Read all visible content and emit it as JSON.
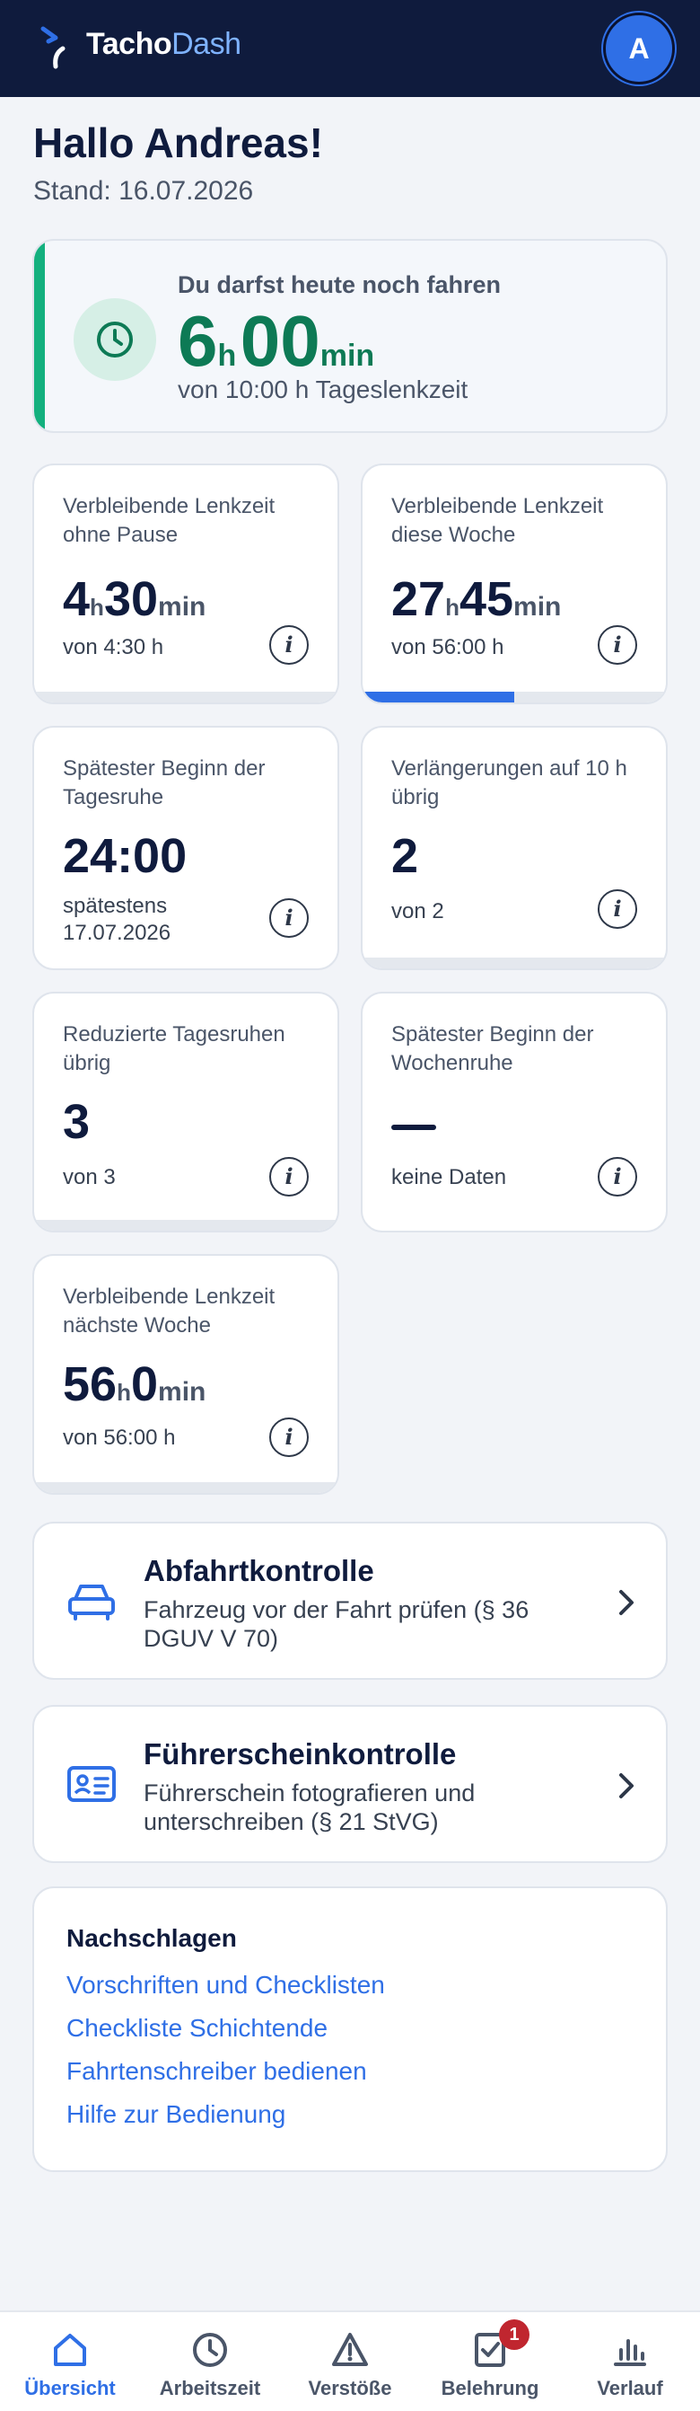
{
  "header": {
    "brand_a": "Tacho",
    "brand_b": "Dash",
    "avatar": "A"
  },
  "greeting": "Hallo Andreas!",
  "stand": "Stand: 16.07.2026",
  "hero": {
    "lead": "Du darfst heute noch fahren",
    "hours": "6",
    "h": "h",
    "minutes": "00",
    "min": "min",
    "sub": "von 10:00 h Tageslenkzeit",
    "accent": "#13b07e"
  },
  "cards": [
    {
      "label": "Verbleibende Lenkzeit ohne Pause",
      "hours": "4",
      "h": "h",
      "minutes": "30",
      "min": "min",
      "caption": "von 4:30 h",
      "progress": 0
    },
    {
      "label": "Verbleibende Lenkzeit diese Woche",
      "hours": "27",
      "h": "h",
      "minutes": "45",
      "min": "min",
      "caption": "von 56:00 h",
      "progress": 0.5
    },
    {
      "label": "Spätester Beginn der Tagesruhe",
      "value": "24:00",
      "caption": "spätestens 17.07.2026"
    },
    {
      "label": "Verlängerungen auf 10 h übrig",
      "value": "2",
      "caption": "von 2",
      "progress": 0
    },
    {
      "label": "Reduzierte Tagesruhen übrig",
      "value": "3",
      "caption": "von 3",
      "progress": 0
    },
    {
      "label": "Spätester Beginn der Wochenruhe",
      "caption": "keine Daten"
    },
    {
      "label": "Verbleibende Lenkzeit nächste Woche",
      "hours": "56",
      "h": "h",
      "minutes": "0",
      "min": "min",
      "caption": "von 56:00 h",
      "progress": 0
    }
  ],
  "info_glyph": "i",
  "actions": [
    {
      "title": "Abfahrtkontrolle",
      "desc": "Fahrzeug vor der Fahrt prüfen (§ 36 DGUV V 70)",
      "icon": "car-icon"
    },
    {
      "title": "Führerscheinkontrolle",
      "desc": "Führerschein fotografieren und unterschreiben (§ 21 StVG)",
      "icon": "id-card-icon"
    }
  ],
  "reference": {
    "heading": "Nachschlagen",
    "links": [
      "Vorschriften und Checklisten",
      "Checkliste Schichtende",
      "Fahrtenschreiber bedienen",
      "Hilfe zur Bedienung"
    ]
  },
  "bottom_nav": [
    {
      "label": "Übersicht",
      "icon": "home-icon",
      "active": true
    },
    {
      "label": "Arbeitszeit",
      "icon": "clock-icon"
    },
    {
      "label": "Verstöße",
      "icon": "warning-icon"
    },
    {
      "label": "Belehrung",
      "icon": "checklist-icon",
      "badge": "1"
    },
    {
      "label": "Verlauf",
      "icon": "bar-chart-icon"
    }
  ],
  "colors": {
    "navy": "#0f1b3d",
    "blue": "#2f6fe6",
    "green": "#0d7a55",
    "badge": "#c0262f"
  }
}
